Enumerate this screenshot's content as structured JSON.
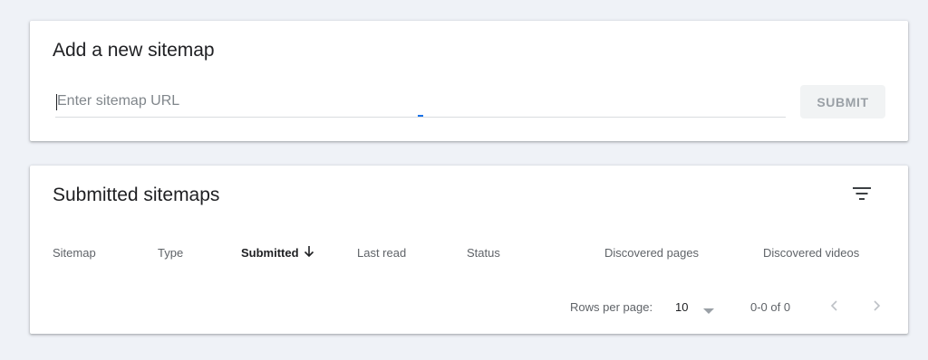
{
  "add_sitemap": {
    "title": "Add a new sitemap",
    "input_placeholder": "Enter sitemap URL",
    "input_value": "",
    "submit_label": "SUBMIT"
  },
  "submitted": {
    "title": "Submitted sitemaps",
    "filter_icon": "filter-list-icon",
    "columns": [
      "Sitemap",
      "Type",
      "Submitted",
      "Last read",
      "Status",
      "Discovered pages",
      "Discovered videos"
    ],
    "sorted_column": "Submitted",
    "sort_direction": "descending",
    "rows": [],
    "pagination": {
      "rows_per_page_label": "Rows per page:",
      "rows_per_page_value": "10",
      "range_label": "0-0 of 0"
    }
  },
  "colors": {
    "page_background": "#eff2f7",
    "card_background": "#ffffff",
    "accent": "#1a73e8",
    "disabled_button_bg": "#f1f3f4",
    "disabled_button_text": "#9aa0a6"
  }
}
